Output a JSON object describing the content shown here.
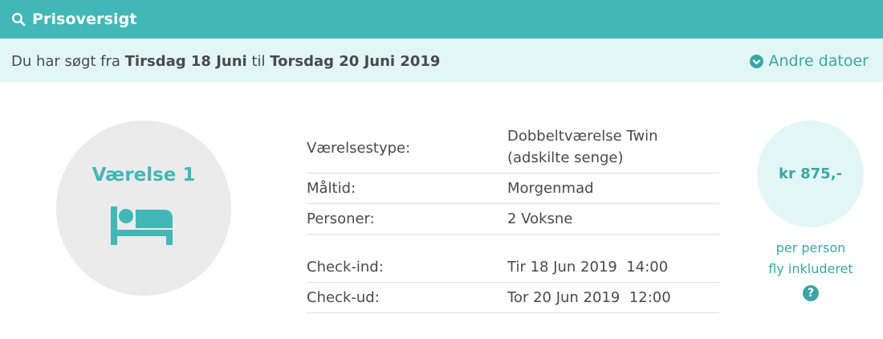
{
  "header": {
    "title": "Prisoversigt",
    "icon": "search-icon"
  },
  "search": {
    "prefix": "Du har søgt fra",
    "from_date": "Tirsdag 18 Juni",
    "connector": "til",
    "to_date": "Torsdag 20 Juni 2019",
    "other_dates_label": "Andre datoer",
    "other_dates_icon": "circle-arrow-down-icon"
  },
  "room": {
    "title": "Værelse 1",
    "icon": "bed-icon",
    "details": [
      {
        "label": "Værelsestype:",
        "value_line1": "Dobbeltværelse Twin",
        "value_line2": "(adskilte senge)"
      },
      {
        "label": "Måltid:",
        "value": "Morgenmad"
      },
      {
        "label": "Personer:",
        "value": "2 Voksne"
      },
      {
        "label": "Check-ind:",
        "value": "Tir 18 Jun 2019  14:00"
      },
      {
        "label": "Check-ud:",
        "value": "Tor 20 Jun 2019  12:00"
      }
    ]
  },
  "price": {
    "amount": "kr 875,-",
    "note_line1": "per person",
    "note_line2": "fly inkluderet",
    "help": "?"
  },
  "colors": {
    "accent": "#41b8b7",
    "accent_dark": "#3aa7a6",
    "light_bg": "#e3f6f7",
    "circle_gray": "#ebebeb"
  }
}
